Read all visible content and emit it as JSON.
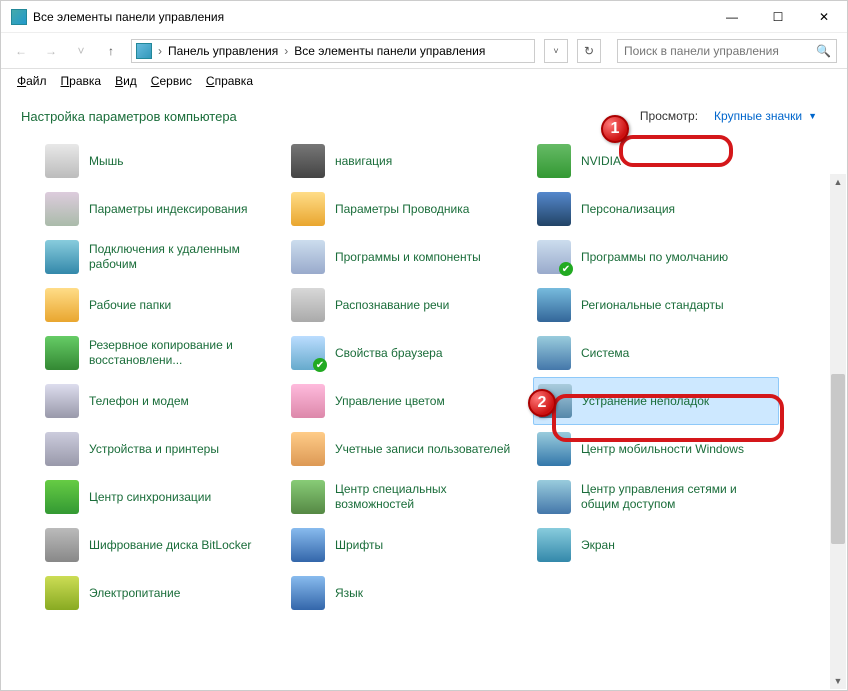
{
  "window": {
    "title": "Все элементы панели управления"
  },
  "titlebar_buttons": {
    "min": "—",
    "max": "☐",
    "close": "✕"
  },
  "nav": {
    "back": "←",
    "forward": "→",
    "dropdown": "˅",
    "up": "↑",
    "crumb1": "Панель управления",
    "crumb2": "Все элементы панели управления",
    "sep": "›",
    "refresh": "↻"
  },
  "search": {
    "placeholder": "Поиск в панели управления",
    "icon": "🔍"
  },
  "menu": {
    "file": "Файл",
    "edit": "Правка",
    "view": "Вид",
    "tools": "Сервис",
    "help": "Справка"
  },
  "heading": "Настройка параметров компьютера",
  "view_label": "Просмотр:",
  "view_selector": "Крупные значки",
  "items": [
    {
      "label": "Мышь",
      "ic": "ic-mouse"
    },
    {
      "label": "навигация",
      "ic": "ic-nav"
    },
    {
      "label": "NVIDIA",
      "ic": "ic-nvidia"
    },
    {
      "label": "Параметры индексирования",
      "ic": "ic-index"
    },
    {
      "label": "Параметры Проводника",
      "ic": "ic-explorer"
    },
    {
      "label": "Персонализация",
      "ic": "ic-personal"
    },
    {
      "label": "Подключения к удаленным рабочим",
      "ic": "ic-remote"
    },
    {
      "label": "Программы и компоненты",
      "ic": "ic-programs"
    },
    {
      "label": "Программы по умолчанию",
      "ic": "ic-defaultprog"
    },
    {
      "label": "Рабочие папки",
      "ic": "ic-folders"
    },
    {
      "label": "Распознавание речи",
      "ic": "ic-speech"
    },
    {
      "label": "Региональные стандарты",
      "ic": "ic-region"
    },
    {
      "label": "Резервное копирование и восстановлени...",
      "ic": "ic-backup"
    },
    {
      "label": "Свойства браузера",
      "ic": "ic-browser"
    },
    {
      "label": "Система",
      "ic": "ic-system"
    },
    {
      "label": "Телефон и модем",
      "ic": "ic-phone"
    },
    {
      "label": "Управление цветом",
      "ic": "ic-color"
    },
    {
      "label": "Устранение неполадок",
      "ic": "ic-troubleshoot",
      "highlight": true
    },
    {
      "label": "Устройства и принтеры",
      "ic": "ic-devices"
    },
    {
      "label": "Учетные записи пользователей",
      "ic": "ic-accounts"
    },
    {
      "label": "Центр мобильности Windows",
      "ic": "ic-mobility"
    },
    {
      "label": "Центр синхронизации",
      "ic": "ic-sync"
    },
    {
      "label": "Центр специальных возможностей",
      "ic": "ic-special"
    },
    {
      "label": "Центр управления сетями и общим доступом",
      "ic": "ic-network"
    },
    {
      "label": "Шифрование диска BitLocker",
      "ic": "ic-bitlocker"
    },
    {
      "label": "Шрифты",
      "ic": "ic-fonts"
    },
    {
      "label": "Экран",
      "ic": "ic-screen"
    },
    {
      "label": "Электропитание",
      "ic": "ic-power"
    },
    {
      "label": "Язык",
      "ic": "ic-lang"
    }
  ],
  "callouts": {
    "one": "1",
    "two": "2"
  }
}
